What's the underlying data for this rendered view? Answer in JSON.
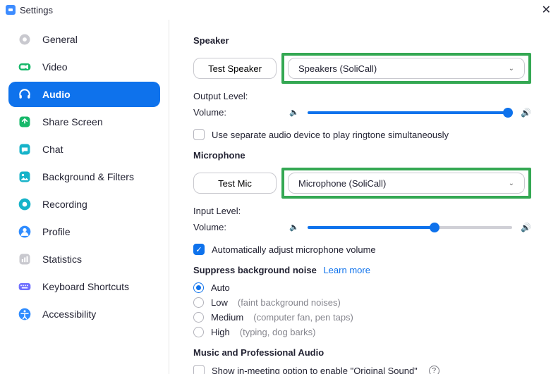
{
  "window": {
    "title": "Settings",
    "close_glyph": "✕"
  },
  "sidebar": {
    "items": [
      {
        "label": "General",
        "icon": "gear-icon",
        "color": "#c9c9cf"
      },
      {
        "label": "Video",
        "icon": "video-icon",
        "color": "#17b86a"
      },
      {
        "label": "Audio",
        "icon": "headphones-icon",
        "color": "#ffffff"
      },
      {
        "label": "Share Screen",
        "icon": "share-icon",
        "color": "#17b86a"
      },
      {
        "label": "Chat",
        "icon": "chat-icon",
        "color": "#17b3c9"
      },
      {
        "label": "Background & Filters",
        "icon": "bg-icon",
        "color": "#17b3c9"
      },
      {
        "label": "Recording",
        "icon": "record-icon",
        "color": "#17b3c9"
      },
      {
        "label": "Profile",
        "icon": "profile-icon",
        "color": "#2f8cff"
      },
      {
        "label": "Statistics",
        "icon": "stats-icon",
        "color": "#c9c9cf"
      },
      {
        "label": "Keyboard Shortcuts",
        "icon": "keyboard-icon",
        "color": "#6f6fff"
      },
      {
        "label": "Accessibility",
        "icon": "access-icon",
        "color": "#2f8cff"
      }
    ],
    "active_index": 2
  },
  "content": {
    "speaker": {
      "heading": "Speaker",
      "test_button": "Test Speaker",
      "selected_device": "Speakers (SoliCall)",
      "output_level_label": "Output Level:",
      "volume_label": "Volume:",
      "volume_percent": 98,
      "separate_device_label": "Use separate audio device to play ringtone simultaneously",
      "separate_device_checked": false
    },
    "microphone": {
      "heading": "Microphone",
      "test_button": "Test Mic",
      "selected_device": "Microphone (SoliCall)",
      "input_level_label": "Input Level:",
      "volume_label": "Volume:",
      "volume_percent": 62,
      "auto_adjust_label": "Automatically adjust microphone volume",
      "auto_adjust_checked": true
    },
    "suppress": {
      "heading": "Suppress background noise",
      "learn_more": "Learn more",
      "options": [
        {
          "label": "Auto",
          "desc": ""
        },
        {
          "label": "Low",
          "desc": "(faint background noises)"
        },
        {
          "label": "Medium",
          "desc": "(computer fan, pen taps)"
        },
        {
          "label": "High",
          "desc": "(typing, dog barks)"
        }
      ],
      "selected_index": 0
    },
    "music": {
      "heading": "Music and Professional Audio",
      "original_sound_label": "Show in-meeting option to enable \"Original Sound\"",
      "original_sound_checked": false
    }
  }
}
